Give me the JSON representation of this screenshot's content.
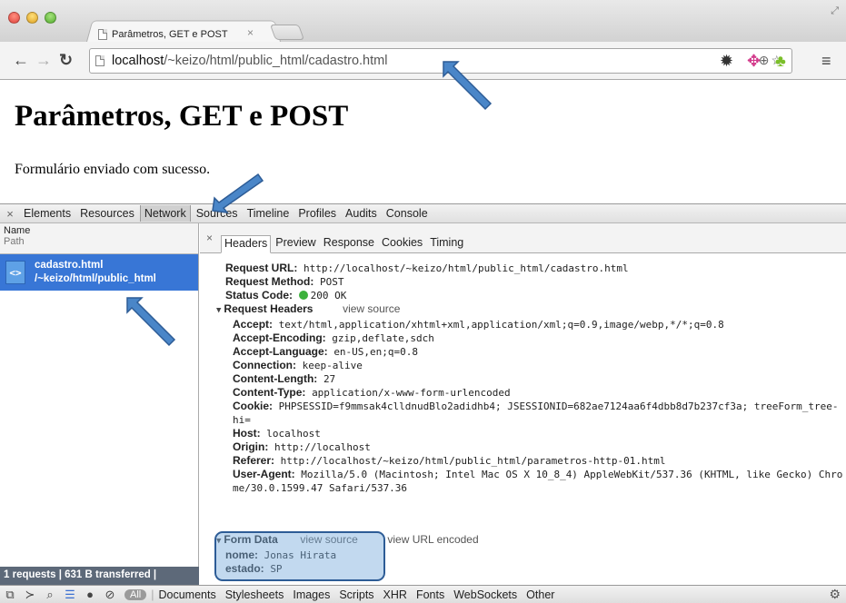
{
  "browser": {
    "tab_title": "Parâmetros, GET e POST",
    "tab_close": "×",
    "url_host": "localhost",
    "url_path": "/~keizo/html/public_html/cadastro.html"
  },
  "page": {
    "title": "Parâmetros, GET e POST",
    "message": "Formulário enviado com sucesso."
  },
  "devtools": {
    "close": "×",
    "tabs": [
      "Elements",
      "Resources",
      "Network",
      "Sources",
      "Timeline",
      "Profiles",
      "Audits",
      "Console"
    ],
    "active_tab": "Network",
    "sidebar": {
      "header_name": "Name",
      "header_path": "Path",
      "request_name": "cadastro.html",
      "request_path": "/~keizo/html/public_html",
      "footer": "1 requests  |  631 B transferred  |"
    },
    "detail": {
      "close": "×",
      "subtabs": [
        "Headers",
        "Preview",
        "Response",
        "Cookies",
        "Timing"
      ],
      "active_subtab": "Headers",
      "request_url_label": "Request URL:",
      "request_url": "http://localhost/~keizo/html/public_html/cadastro.html",
      "request_method_label": "Request Method:",
      "request_method": "POST",
      "status_code_label": "Status Code:",
      "status_code": "200 OK",
      "request_headers_label": "Request Headers",
      "view_source": "view source",
      "view_url_encoded": "view URL encoded",
      "headers": [
        {
          "k": "Accept:",
          "v": "text/html,application/xhtml+xml,application/xml;q=0.9,image/webp,*/*;q=0.8"
        },
        {
          "k": "Accept-Encoding:",
          "v": "gzip,deflate,sdch"
        },
        {
          "k": "Accept-Language:",
          "v": "en-US,en;q=0.8"
        },
        {
          "k": "Connection:",
          "v": "keep-alive"
        },
        {
          "k": "Content-Length:",
          "v": "27"
        },
        {
          "k": "Content-Type:",
          "v": "application/x-www-form-urlencoded"
        },
        {
          "k": "Cookie:",
          "v": "PHPSESSID=f9mmsak4clldnudBlo2adidhb4; JSESSIONID=682ae7124aa6f4dbb8d7b237cf3a; treeForm_tree-hi="
        },
        {
          "k": "Host:",
          "v": "localhost"
        },
        {
          "k": "Origin:",
          "v": "http://localhost"
        },
        {
          "k": "Referer:",
          "v": "http://localhost/~keizo/html/public_html/parametros-http-01.html"
        },
        {
          "k": "User-Agent:",
          "v": "Mozilla/5.0 (Macintosh; Intel Mac OS X 10_8_4) AppleWebKit/537.36 (KHTML, like Gecko) Chrome/30.0.1599.47 Safari/537.36"
        }
      ],
      "form_data_label": "Form Data",
      "form_data": [
        {
          "k": "nome:",
          "v": "Jonas Hirata"
        },
        {
          "k": "estado:",
          "v": "SP"
        }
      ]
    },
    "filters": [
      "All",
      "Documents",
      "Stylesheets",
      "Images",
      "Scripts",
      "XHR",
      "Fonts",
      "WebSockets",
      "Other"
    ],
    "active_filter": "All"
  },
  "colors": {
    "selected_row": "#3876d6",
    "sidebar_footer": "#5d6979",
    "annotation": "#4a86c8",
    "status_ok": "#3cb13c"
  }
}
